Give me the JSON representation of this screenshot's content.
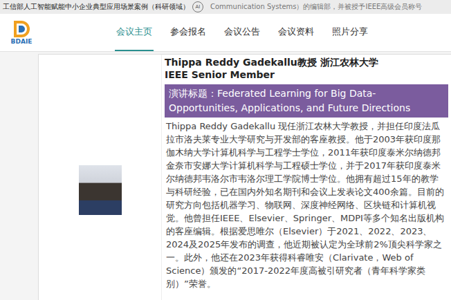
{
  "banner": {
    "title": "工信部人工智能赋能中小企业典型应用场景案例（科研领域）",
    "badge": "AI",
    "background_text": "Communication Systems）的编辑部，并被授予IEEE高级会员称号"
  },
  "logo": {
    "text": "BDAIE"
  },
  "tabs": [
    {
      "label": "会议主页",
      "selected": true
    },
    {
      "label": "参会报名",
      "selected": false
    },
    {
      "label": "会议公告",
      "selected": false
    },
    {
      "label": "会议资料",
      "selected": false
    },
    {
      "label": "照片分享",
      "selected": false
    }
  ],
  "speaker": {
    "name": "Thippa Reddy Gadekallu教授 浙江农林大学",
    "title": "IEEE Senior Member",
    "talk": "演讲标题：Federated Learning for Big Data- Opportunities, Applications, and Future Directions",
    "bio": "Thippa Reddy Gadekallu 现任浙江农林大学教授，并担任印度法瓜拉市洛夫莱专业大学研究与开发部的客座教授。他于2003年获印度那伽木纳大学计算机科学与工程学士学位，2011年获印度泰米尔纳德邦金奈市安娜大学计算机科学与工程硕士学位，并于2017年获印度泰米尔纳德邦韦洛尔市韦洛尔理工学院博士学位。他拥有超过15年的教学与科研经验，已在国内外知名期刊和会议上发表论文400余篇。目前的研究方向包括机器学习、物联网、深度神经网络、区块链和计算机视觉。他曾担任IEEE、Elsevier、Springer、MDPI等多个知名出版机构的客座编辑。根据爱思唯尔（Elsevier）于2021、2022、2023、2024及2025年发布的调查，他近期被认定为全球前2%顶尖科学家之一。此外，他还在2023年获得科睿唯安（Clarivate，Web of Science）颁发的“2017-2022年度高被引研究者（青年科学家类别）”荣誉。"
  }
}
